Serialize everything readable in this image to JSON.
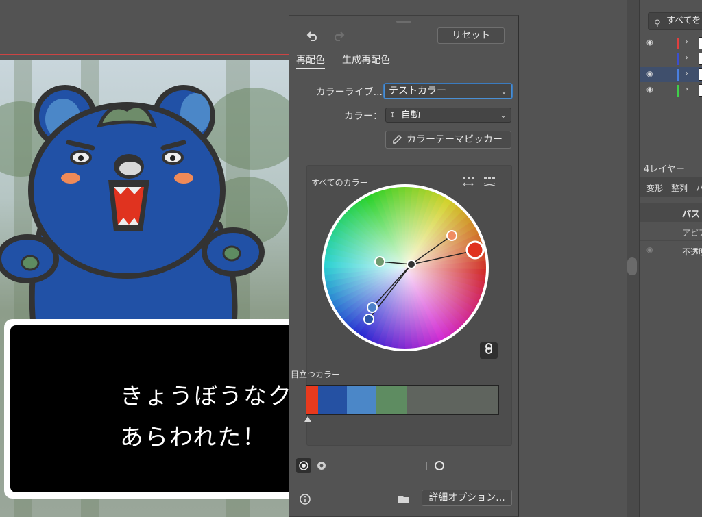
{
  "canvas": {
    "dialog_line1": "きょうぼうなクマ",
    "dialog_line2": "あらわれた！"
  },
  "panel": {
    "undo_icon": "undo-icon",
    "redo_icon": "redo-icon",
    "reset_label": "リセット",
    "tabs": [
      {
        "label": "再配色"
      },
      {
        "label": "生成再配色"
      }
    ],
    "library_label": "カラーライブ...",
    "library_value": "テストカラー",
    "color_label": "カラー：",
    "color_value": "自動",
    "picker_label": "カラーテーマピッカー",
    "wheel_title": "すべてのカラー",
    "prominent_title": "目立つカラー",
    "prominent_colors": [
      "#e83a1e",
      "#2551a3",
      "#4b87c8",
      "#5e8c61",
      "#5f645e"
    ],
    "prominent_weights": [
      0.06,
      0.15,
      0.15,
      0.16,
      0.48
    ],
    "details_label": "詳細オプション...",
    "slider_value": 0.6
  },
  "layers": {
    "search_placeholder": "すべてを",
    "rows": [
      {
        "color": "#e0403f",
        "selected": false,
        "visible": true
      },
      {
        "color": "#3b4fd0",
        "selected": false,
        "visible": false
      },
      {
        "color": "#4a7fe0",
        "selected": true,
        "visible": true
      },
      {
        "color": "#3fcf4a",
        "selected": false,
        "visible": true
      }
    ],
    "count_label": "4レイヤー",
    "tabs": [
      "変形",
      "整列",
      "パ"
    ],
    "props_title": "パス",
    "props_appearance": "アピア",
    "props_opacity": "不透明"
  }
}
